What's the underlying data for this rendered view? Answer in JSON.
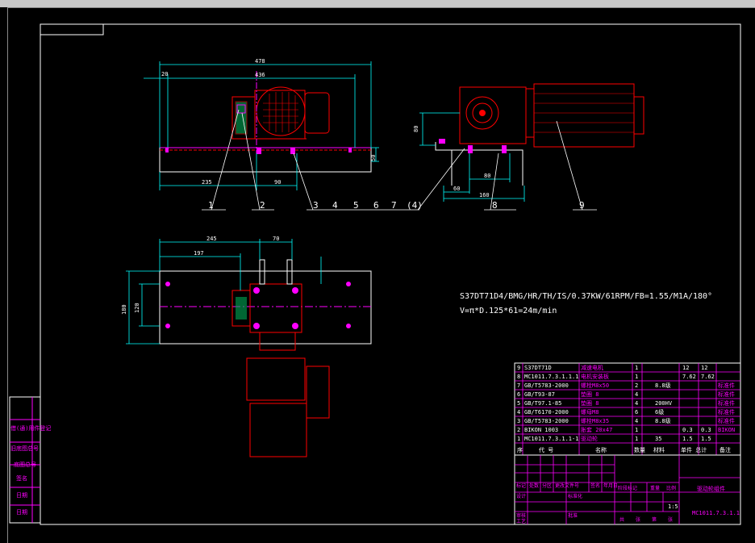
{
  "spec": {
    "line1": "S37DT71D4/BMG/HR/TH/IS/0.37KW/61RPM/FB=1.55/M1A/180°",
    "line2": "V=π*D.125*61=24m/min"
  },
  "dims_top": {
    "d478": "478",
    "d20": "20",
    "d436": "436",
    "d80": "80",
    "d50": "50",
    "d235": "235",
    "d90": "90",
    "d60": "60",
    "d160": "160"
  },
  "dims_plan": {
    "d245": "245",
    "d70": "70",
    "d197": "197",
    "d180": "180",
    "d120": "120"
  },
  "balloons": [
    "1",
    "2",
    "3",
    "4",
    "5",
    "6",
    "7",
    "(4)",
    "8",
    "9"
  ],
  "bom": [
    {
      "no": "9",
      "code": "S37DT71D",
      "name": "减速电机",
      "qty": "1",
      "mat": "",
      "w1": "12",
      "w2": "12",
      "note": ""
    },
    {
      "no": "8",
      "code": "MC1011.7.3.1.1.1",
      "name": "电机安装板",
      "qty": "1",
      "mat": "",
      "w1": "7.62",
      "w2": "7.62",
      "note": ""
    },
    {
      "no": "7",
      "code": "GB/T5783-2000",
      "name": "螺栓M8x50",
      "qty": "2",
      "mat": "8.8级",
      "w1": "",
      "w2": "",
      "note": "标准件"
    },
    {
      "no": "6",
      "code": "GB/T93-87",
      "name": "垫圈 8",
      "qty": "4",
      "mat": "",
      "w1": "",
      "w2": "",
      "note": "标准件"
    },
    {
      "no": "5",
      "code": "GB/T97.1-85",
      "name": "垫圈 8",
      "qty": "4",
      "mat": "200HV",
      "w1": "",
      "w2": "",
      "note": "标准件"
    },
    {
      "no": "4",
      "code": "GB/T6170-2000",
      "name": "螺母M8",
      "qty": "6",
      "mat": "6级",
      "w1": "",
      "w2": "",
      "note": "标准件"
    },
    {
      "no": "3",
      "code": "GB/T5783-2000",
      "name": "螺栓M8x35",
      "qty": "4",
      "mat": "8.8级",
      "w1": "",
      "w2": "",
      "note": "标准件"
    },
    {
      "no": "2",
      "code": "BIKON 1003",
      "name": "胀套 20x47",
      "qty": "1",
      "mat": "",
      "w1": "0.3",
      "w2": "0.3",
      "note": "BIKON"
    },
    {
      "no": "1",
      "code": "MC1011.7.3.1.1-1",
      "name": "驱动轮",
      "qty": "1",
      "mat": "35",
      "w1": "1.5",
      "w2": "1.5",
      "note": ""
    }
  ],
  "bom_header": {
    "no": "序",
    "code": "代 号",
    "name": "名称",
    "qty": "数量",
    "mat": "材料",
    "w": "单件 总计",
    "note": "备注"
  },
  "title_block": {
    "title": "驱动轮组件",
    "drawing_no": "MC1011.7.3.1.1",
    "scale": "1:5",
    "row_labels": [
      "标记",
      "处数",
      "分区",
      "更改文件号",
      "签名",
      "年月日"
    ],
    "roles": [
      "设计",
      "审核",
      "工艺",
      "标准化",
      "批准"
    ],
    "stage_labels": [
      "阶段标记",
      "重量",
      "比例"
    ],
    "sheet_labels": [
      "共",
      "张",
      "第",
      "张"
    ]
  },
  "side_table": [
    "借(通)用件登记",
    "旧底图总号",
    "底图总号",
    "签名",
    "日期",
    "日期"
  ],
  "colors": {
    "background": "#000000",
    "outline": "#ff0000",
    "dimension": "#00ffff",
    "frame": "#ffffff",
    "center": "#ff00ff",
    "hidden": "#ff00ff",
    "table": "#ff00ff",
    "text": "#ffffff"
  }
}
